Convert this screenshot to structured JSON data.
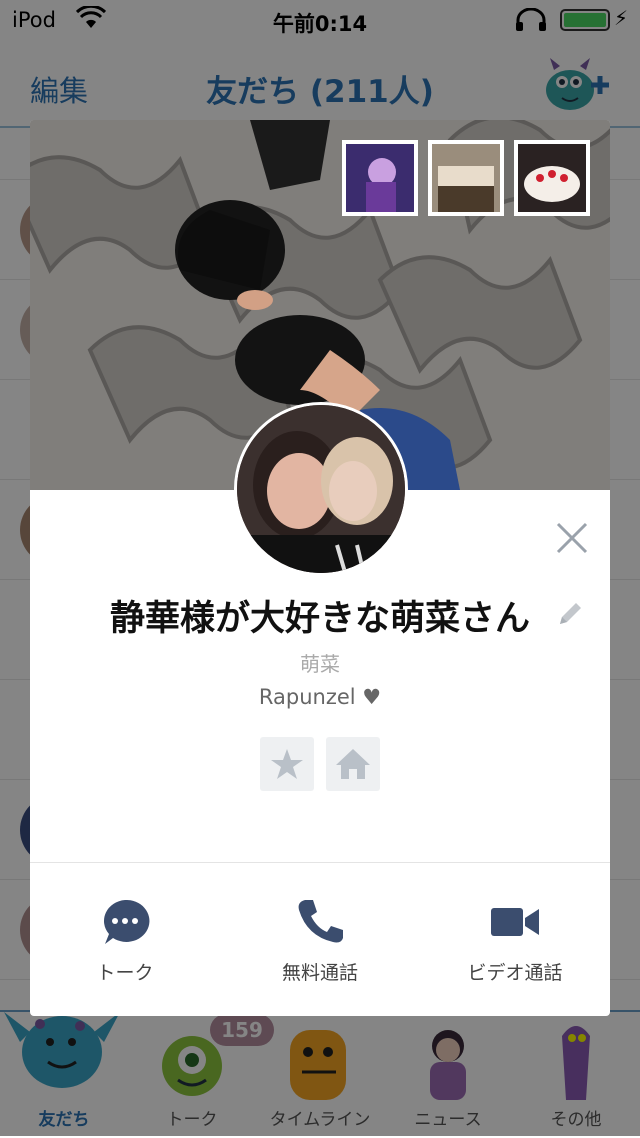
{
  "status_bar": {
    "carrier": "iPod",
    "time": "午前0:14"
  },
  "nav": {
    "edit_label": "編集",
    "title": "友だち (211人)"
  },
  "tabs": [
    {
      "label": "友だち",
      "active": true
    },
    {
      "label": "トーク",
      "badge": "159"
    },
    {
      "label": "タイムライン"
    },
    {
      "label": "ニュース"
    },
    {
      "label": "その他"
    }
  ],
  "profile": {
    "display_name": "静華様が大好きな萌菜さん",
    "original_name": "萌菜",
    "status_message": "Rapunzel ♥"
  },
  "actions": {
    "talk": "トーク",
    "free_call": "無料通話",
    "video_call": "ビデオ通話"
  },
  "colors": {
    "accent": "#2c74b5",
    "action_icon": "#3b4d6e",
    "battery": "#4cd964"
  }
}
